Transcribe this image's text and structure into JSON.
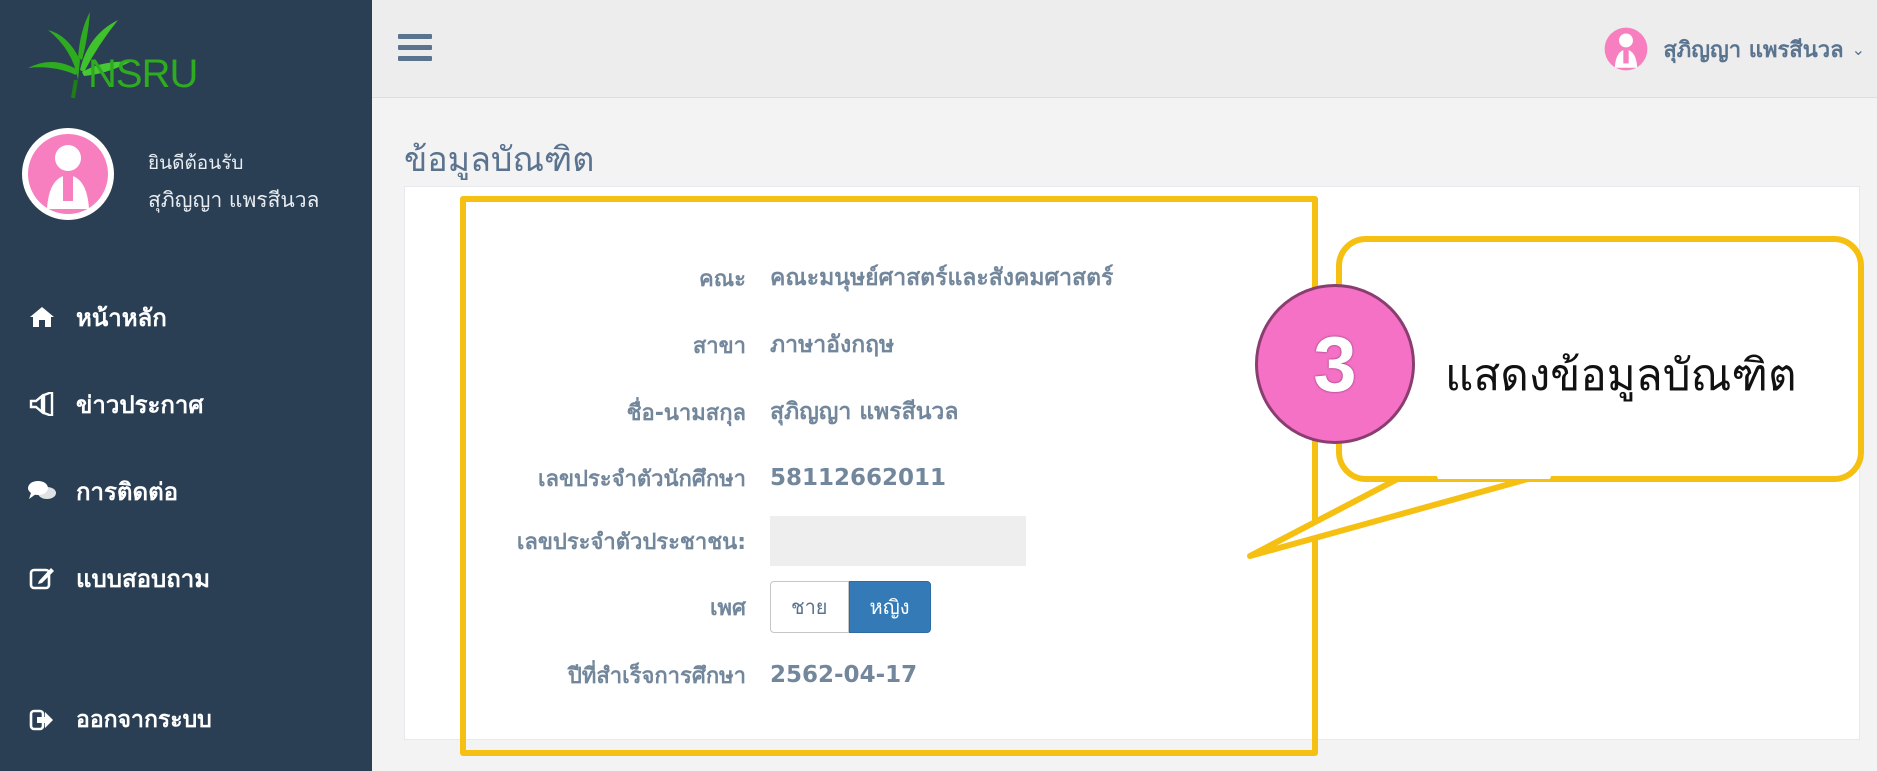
{
  "brand": {
    "logo_text": "NSRU"
  },
  "sidebar": {
    "welcome": "ยินดีต้อนรับ",
    "user_name": "สุภิญญา แพรสีนวล",
    "items": [
      {
        "label": "หน้าหลัก",
        "icon": "home-icon"
      },
      {
        "label": "ข่าวประกาศ",
        "icon": "bullhorn-icon"
      },
      {
        "label": "การติดต่อ",
        "icon": "comments-icon"
      },
      {
        "label": "แบบสอบถาม",
        "icon": "edit-icon"
      }
    ],
    "logout": {
      "label": "ออกจากระบบ",
      "icon": "sign-out-icon"
    }
  },
  "topbar": {
    "user_name": "สุภิญญา แพรสีนวล",
    "caret": "⌄"
  },
  "main": {
    "title": "ข้อมูลบัณฑิต",
    "fields": {
      "faculty_label": "คณะ",
      "faculty_value": "คณะมนุษย์ศาสตร์และสังคมศาสตร์",
      "major_label": "สาขา",
      "major_value": "ภาษาอังกฤษ",
      "name_label": "ชื่อ-นามสกุล",
      "name_value": "สุภิญญา แพรสีนวล",
      "student_id_label": "เลขประจำตัวนักศึกษา",
      "student_id_value": "58112662011",
      "citizen_id_label": "เลขประจำตัวประชาชน:",
      "citizen_id_value": "",
      "gender_label": "เพศ",
      "gender_options": [
        "ชาย",
        "หญิง"
      ],
      "gender_selected": "หญิง",
      "grad_label": "ปีที่สำเร็จการศึกษา",
      "grad_value": "2562-04-17"
    }
  },
  "callout": {
    "step": "3",
    "text": "แสดงข้อมูลบัณฑิต"
  },
  "colors": {
    "sidebar": "#2a3f54",
    "highlight": "#f6c012",
    "step": "#f571c6",
    "selected": "#337ab7"
  }
}
